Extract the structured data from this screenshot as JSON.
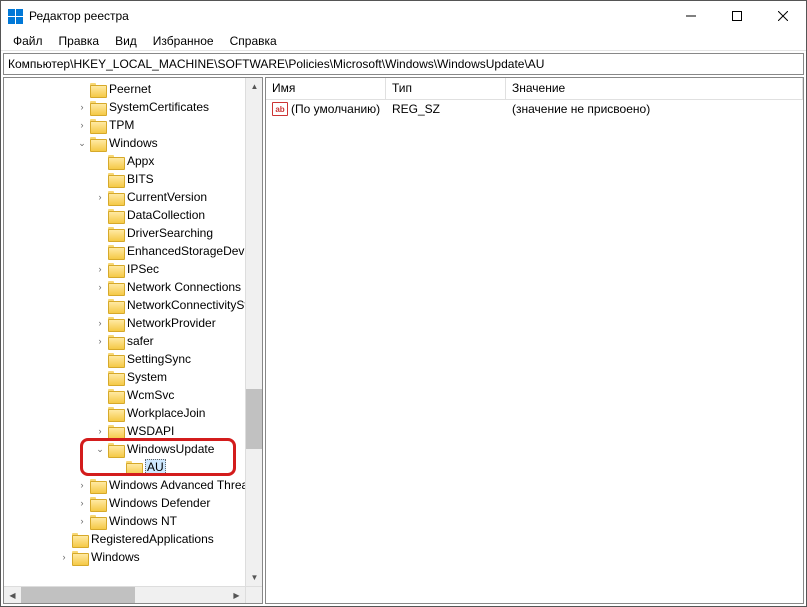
{
  "titlebar": {
    "title": "Редактор реестра"
  },
  "menu": {
    "file": "Файл",
    "edit": "Правка",
    "view": "Вид",
    "favorites": "Избранное",
    "help": "Справка"
  },
  "address": "Компьютер\\HKEY_LOCAL_MACHINE\\SOFTWARE\\Policies\\Microsoft\\Windows\\WindowsUpdate\\AU",
  "tree": [
    {
      "indent": 72,
      "expander": "",
      "label": "Peernet"
    },
    {
      "indent": 72,
      "expander": ">",
      "label": "SystemCertificates"
    },
    {
      "indent": 72,
      "expander": ">",
      "label": "TPM"
    },
    {
      "indent": 72,
      "expander": "v",
      "label": "Windows"
    },
    {
      "indent": 90,
      "expander": "",
      "label": "Appx"
    },
    {
      "indent": 90,
      "expander": "",
      "label": "BITS"
    },
    {
      "indent": 90,
      "expander": ">",
      "label": "CurrentVersion"
    },
    {
      "indent": 90,
      "expander": "",
      "label": "DataCollection"
    },
    {
      "indent": 90,
      "expander": "",
      "label": "DriverSearching"
    },
    {
      "indent": 90,
      "expander": "",
      "label": "EnhancedStorageDevices"
    },
    {
      "indent": 90,
      "expander": ">",
      "label": "IPSec"
    },
    {
      "indent": 90,
      "expander": ">",
      "label": "Network Connections"
    },
    {
      "indent": 90,
      "expander": "",
      "label": "NetworkConnectivityStat"
    },
    {
      "indent": 90,
      "expander": ">",
      "label": "NetworkProvider"
    },
    {
      "indent": 90,
      "expander": ">",
      "label": "safer"
    },
    {
      "indent": 90,
      "expander": "",
      "label": "SettingSync"
    },
    {
      "indent": 90,
      "expander": "",
      "label": "System"
    },
    {
      "indent": 90,
      "expander": "",
      "label": "WcmSvc"
    },
    {
      "indent": 90,
      "expander": "",
      "label": "WorkplaceJoin"
    },
    {
      "indent": 90,
      "expander": ">",
      "label": "WSDAPI"
    },
    {
      "indent": 90,
      "expander": "v",
      "label": "WindowsUpdate"
    },
    {
      "indent": 108,
      "expander": "",
      "label": "AU",
      "selected": true
    },
    {
      "indent": 72,
      "expander": ">",
      "label": "Windows Advanced Threat P"
    },
    {
      "indent": 72,
      "expander": ">",
      "label": "Windows Defender"
    },
    {
      "indent": 72,
      "expander": ">",
      "label": "Windows NT"
    },
    {
      "indent": 54,
      "expander": "",
      "label": "RegisteredApplications"
    },
    {
      "indent": 54,
      "expander": ">",
      "label": "Windows"
    }
  ],
  "columns": {
    "name": "Имя",
    "type": "Тип",
    "data": "Значение"
  },
  "values": [
    {
      "name": "(По умолчанию)",
      "type": "REG_SZ",
      "data": "(значение не присвоено)"
    }
  ],
  "icon_labels": {
    "string_value": "ab"
  }
}
